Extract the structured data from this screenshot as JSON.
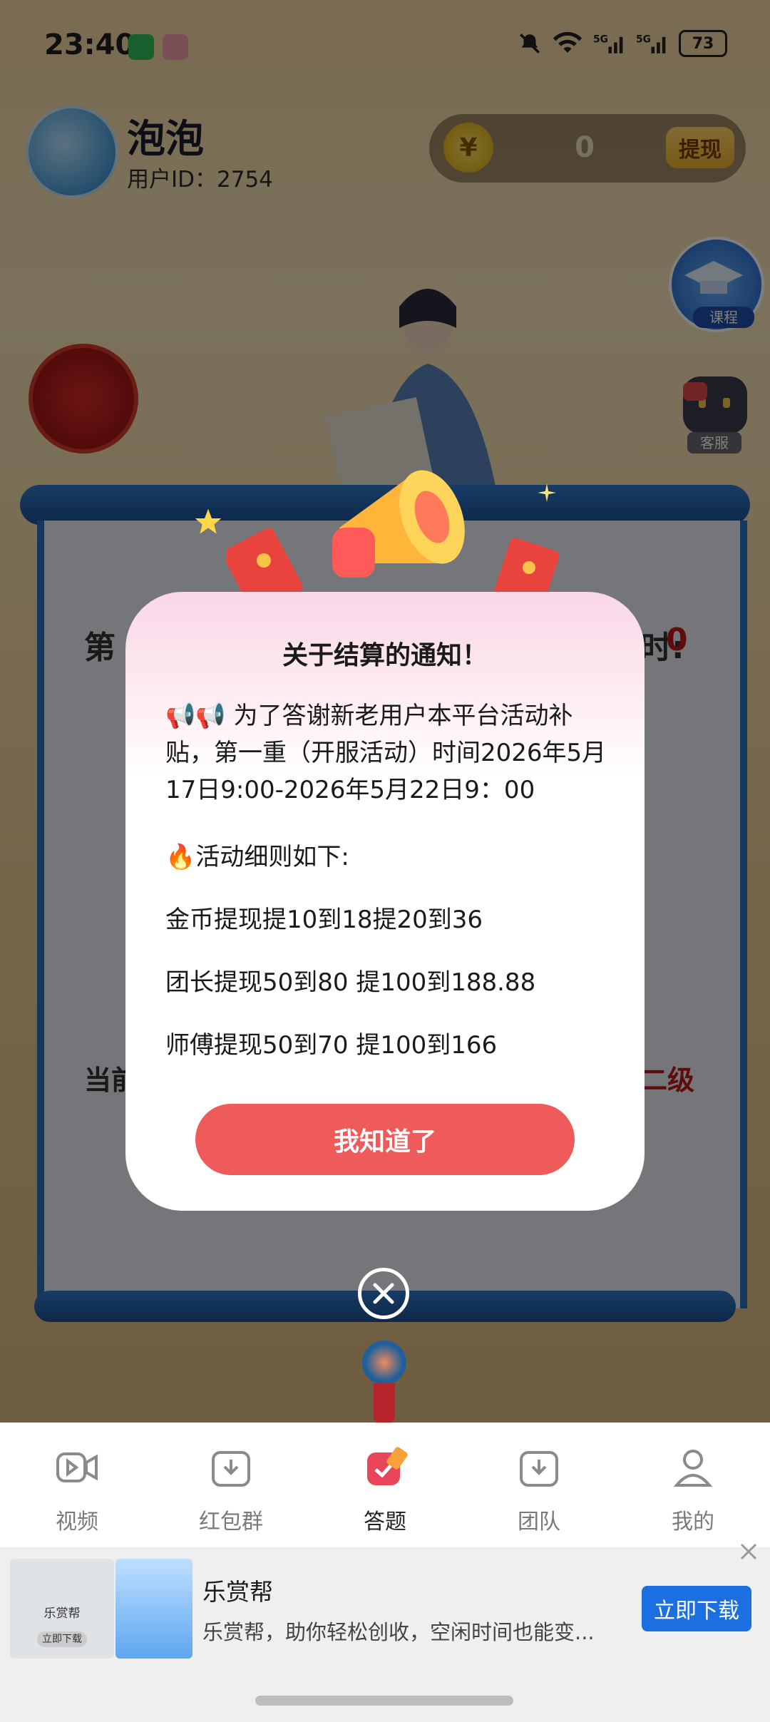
{
  "status_bar": {
    "time": "23:40",
    "battery": "73",
    "network": "5G"
  },
  "header": {
    "username": "泡泡",
    "user_id": "用户ID：2754",
    "coin_symbol": "¥",
    "coin_value": "0",
    "withdraw_label": "提现"
  },
  "side": {
    "course_label": "课程",
    "service_label": "客服"
  },
  "background": {
    "left_text": "第",
    "right_text": "时:",
    "right_value": "0",
    "level_left": "当前",
    "level_right": "二级"
  },
  "dialog": {
    "title": "关于结算的通知！",
    "intro": "📢📢 为了答谢新老用户本平台活动补贴，第一重（开服活动）时间2026年5月17日9:00-2026年5月22日9：00",
    "rules_heading": "🔥活动细则如下:",
    "rule_1": "金币提现提10到18提20到36",
    "rule_2": "团长提现50到80 提100到188.88",
    "rule_3": "师傅提现50到70 提100到166",
    "ok_label": "我知道了"
  },
  "bottom_nav": {
    "items": [
      {
        "label": "视频",
        "icon": "video-icon",
        "active": false
      },
      {
        "label": "红包群",
        "icon": "red-packet-group-icon",
        "active": false
      },
      {
        "label": "答题",
        "icon": "quiz-icon",
        "active": true
      },
      {
        "label": "团队",
        "icon": "team-icon",
        "active": false
      },
      {
        "label": "我的",
        "icon": "profile-icon",
        "active": false
      }
    ]
  },
  "ad": {
    "img_title": "乐赏帮",
    "img_btn": "立即下载",
    "title": "乐赏帮",
    "description": "乐赏帮，助你轻松创收，空闲时间也能变...",
    "cta": "立即下载"
  },
  "colors": {
    "accent_red": "#ef5a5a",
    "scroll_blue": "#2b6eb8",
    "ad_blue": "#1b6fe0"
  }
}
